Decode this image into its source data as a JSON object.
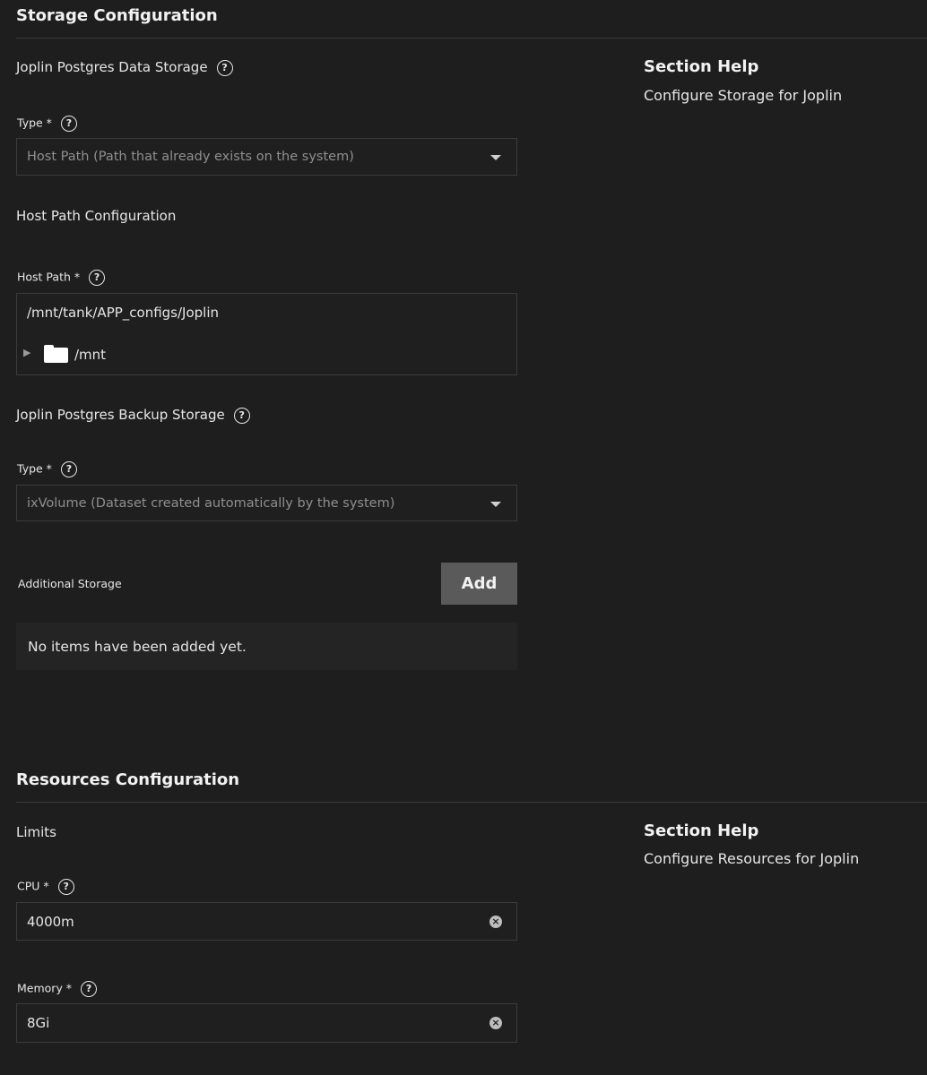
{
  "storage": {
    "title": "Storage Configuration",
    "data_storage_label": "Joplin Postgres Data Storage",
    "type1_label": "Type *",
    "type1_value": "Host Path (Path that already exists on the system)",
    "host_path_config_label": "Host Path Configuration",
    "host_path_label": "Host Path *",
    "host_path_value": "/mnt/tank/APP_configs/Joplin",
    "tree_node": "/mnt",
    "backup_storage_label": "Joplin Postgres Backup Storage",
    "type2_label": "Type *",
    "type2_value": "ixVolume (Dataset created automatically by the system)",
    "additional_label": "Additional Storage",
    "add_button": "Add",
    "empty_message": "No items have been added yet.",
    "help_title": "Section Help",
    "help_text": "Configure Storage for Joplin"
  },
  "resources": {
    "title": "Resources Configuration",
    "limits_label": "Limits",
    "cpu_label": "CPU *",
    "cpu_value": "4000m",
    "memory_label": "Memory *",
    "memory_value": "8Gi",
    "help_title": "Section Help",
    "help_text": "Configure Resources for Joplin"
  },
  "icons": {
    "help": "?",
    "clear": "×",
    "expand": "▶"
  }
}
